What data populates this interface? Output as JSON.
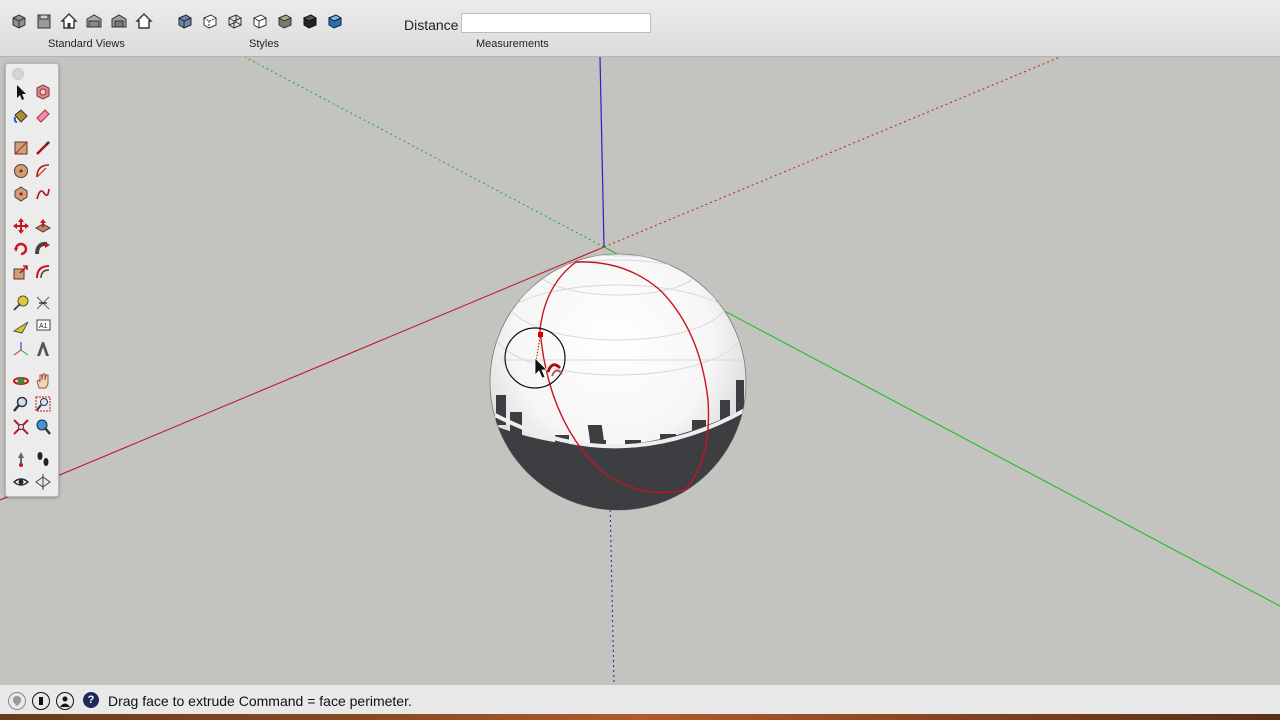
{
  "toolbar": {
    "standard_views_label": "Standard Views",
    "styles_label": "Styles",
    "measurements_label": "Measurements",
    "standard_views_icons": [
      "iso-view-icon",
      "top-view-icon",
      "front-view-icon",
      "right-view-icon",
      "back-view-icon",
      "left-view-icon"
    ],
    "styles_icons": [
      "xray-style-icon",
      "back-edges-style-icon",
      "wireframe-style-icon",
      "hidden-line-style-icon",
      "shaded-style-icon",
      "shaded-textures-style-icon",
      "monochrome-style-icon"
    ]
  },
  "measurements": {
    "label": "Distance",
    "value": ""
  },
  "palette": {
    "tools": [
      "select-tool-icon",
      "make-component-tool-icon",
      "paint-bucket-tool-icon",
      "eraser-tool-icon",
      "rectangle-tool-icon",
      "line-tool-icon",
      "circle-tool-icon",
      "arc-tool-icon",
      "polygon-tool-icon",
      "freehand-tool-icon",
      "move-tool-icon",
      "push-pull-tool-icon",
      "rotate-tool-icon",
      "follow-me-tool-icon",
      "scale-tool-icon",
      "offset-tool-icon",
      "tape-measure-tool-icon",
      "dimension-tool-icon",
      "protractor-tool-icon",
      "text-tool-icon",
      "axes-tool-icon",
      "3d-text-tool-icon",
      "orbit-tool-icon",
      "pan-tool-icon",
      "zoom-tool-icon",
      "zoom-window-tool-icon",
      "zoom-extents-tool-icon",
      "previous-view-tool-icon",
      "position-camera-tool-icon",
      "walk-tool-icon",
      "look-around-tool-icon",
      "section-plane-tool-icon"
    ]
  },
  "status": {
    "text": "Drag face to extrude  Command = face perimeter.",
    "icons": [
      "geo-location-icon",
      "credits-icon",
      "user-icon",
      "help-icon"
    ]
  },
  "colors": {
    "background": "#c3c3bf",
    "red_axis": "#c01a2a",
    "green_axis": "#1fbf1f",
    "blue_axis": "#2222cc",
    "highlight": "#c8141e"
  }
}
